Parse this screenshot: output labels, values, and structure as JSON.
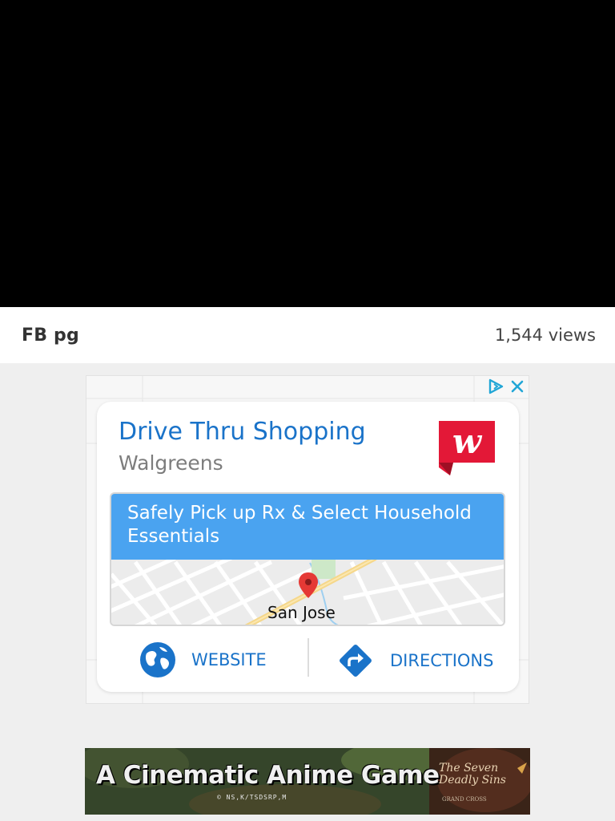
{
  "video": {
    "state": "black"
  },
  "info": {
    "title": "FB pg",
    "views": "1,544 views"
  },
  "ad": {
    "choices_icon": "adchoices-icon",
    "close_icon": "close-icon",
    "headline": "Drive Thru Shopping",
    "advertiser": "Walgreens",
    "logo_icon": "walgreens-logo",
    "banner_text": "Safely Pick up Rx & Select Household Essentials",
    "city": "San Jose",
    "website_label": "WEBSITE",
    "directions_label": "DIRECTIONS",
    "accent_color": "#1a73c9",
    "brand_color": "#e31837"
  },
  "banner_ad": {
    "headline": "A Cinematic Anime Game",
    "copyright": "© NS,K/TSDSRP,M",
    "logo_line1": "The Seven",
    "logo_line2": "Deadly Sins",
    "logo_sub": "GRAND CROSS"
  }
}
